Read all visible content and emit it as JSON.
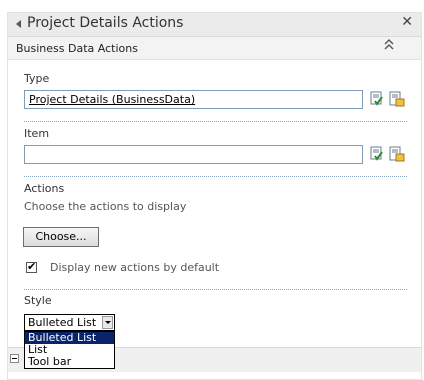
{
  "panel": {
    "title": "Project Details Actions",
    "close_glyph": "✕",
    "subheader": "Business Data Actions",
    "collapse_glyph": "⌃⌃"
  },
  "type_section": {
    "label": "Type",
    "value": "Project Details (BusinessData)"
  },
  "item_section": {
    "label": "Item",
    "value": ""
  },
  "actions_section": {
    "label": "Actions",
    "description": "Choose the actions to display",
    "choose_button": "Choose...",
    "checkbox_label": "Display new actions by default",
    "checkbox_checked": true,
    "check_glyph": "✔"
  },
  "style_section": {
    "label": "Style",
    "selected": "Bulleted List",
    "options": [
      "Bulleted List",
      "List",
      "Tool bar"
    ]
  },
  "icons": [
    "browse-icon",
    "check-names-icon"
  ]
}
